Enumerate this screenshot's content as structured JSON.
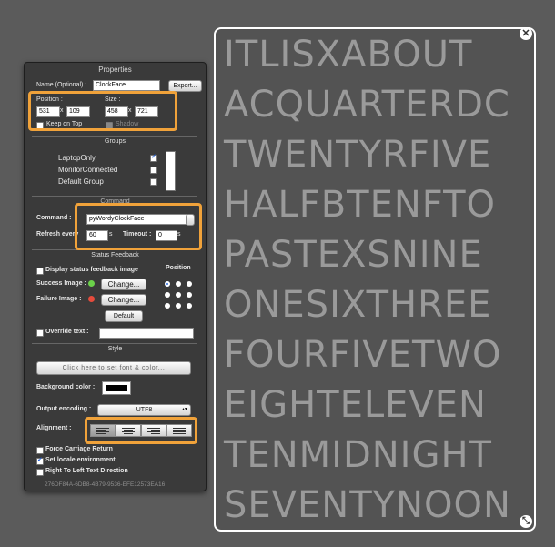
{
  "properties": {
    "title": "Properties",
    "name_label": "Name (Optional) :",
    "name_value": "ClockFace",
    "export_button": "Export...",
    "position_label": "Position :",
    "size_label": "Size :",
    "pos_x": "531",
    "pos_y": "109",
    "size_w": "458",
    "size_h": "721",
    "times": "x",
    "keep_on_top": "Keep on Top",
    "shadow": "Shadow"
  },
  "groups": {
    "title": "Groups",
    "items": [
      {
        "label": "LaptopOnly",
        "checked": true
      },
      {
        "label": "MonitorConnected",
        "checked": false
      },
      {
        "label": "Default Group",
        "checked": false
      }
    ]
  },
  "command": {
    "title": "Command",
    "command_label": "Command :",
    "command_value": "pyWordyClockFace",
    "refresh_label": "Refresh every",
    "refresh_value": "60",
    "refresh_unit": "s",
    "timeout_label": "Timeout :",
    "timeout_value": "0",
    "timeout_unit": "s"
  },
  "status_feedback": {
    "title": "Status Feedback",
    "display_status": "Display status feedback image",
    "position_label": "Position",
    "success_label": "Success Image :",
    "failure_label": "Failure Image :",
    "change_button": "Change...",
    "default_button": "Default",
    "override_label": "Override text :"
  },
  "style": {
    "title": "Style",
    "font_button": "Click here to set font & color...",
    "bg_color_label": "Background color :",
    "bg_color": "#000000",
    "encoding_label": "Output encoding :",
    "encoding_value": "UTF8",
    "alignment_label": "Alignment :",
    "force_cr": "Force Carriage Return",
    "set_locale": "Set locale environment",
    "rtl": "Right To Left Text Direction",
    "uuid": "276DF84A-6DB8-4B79-9536-EFE12573EA16"
  },
  "clock": {
    "rows": [
      "ITLISXABOUT",
      "ACQUARTERDC",
      "TWENTYRFIVE",
      "HALFBTENFTO",
      "PASTEXSNINE",
      "ONESIXTHREE",
      "FOURFIVETWO",
      "EIGHTELEVEN",
      "TENMIDNIGHT",
      "SEVENTYNOON"
    ],
    "close_glyph": "✕",
    "resize_glyph": "⤡"
  },
  "colors": {
    "highlight": "#f0a23a",
    "panel": "#3a3a3a",
    "background": "#5b5b5b"
  }
}
